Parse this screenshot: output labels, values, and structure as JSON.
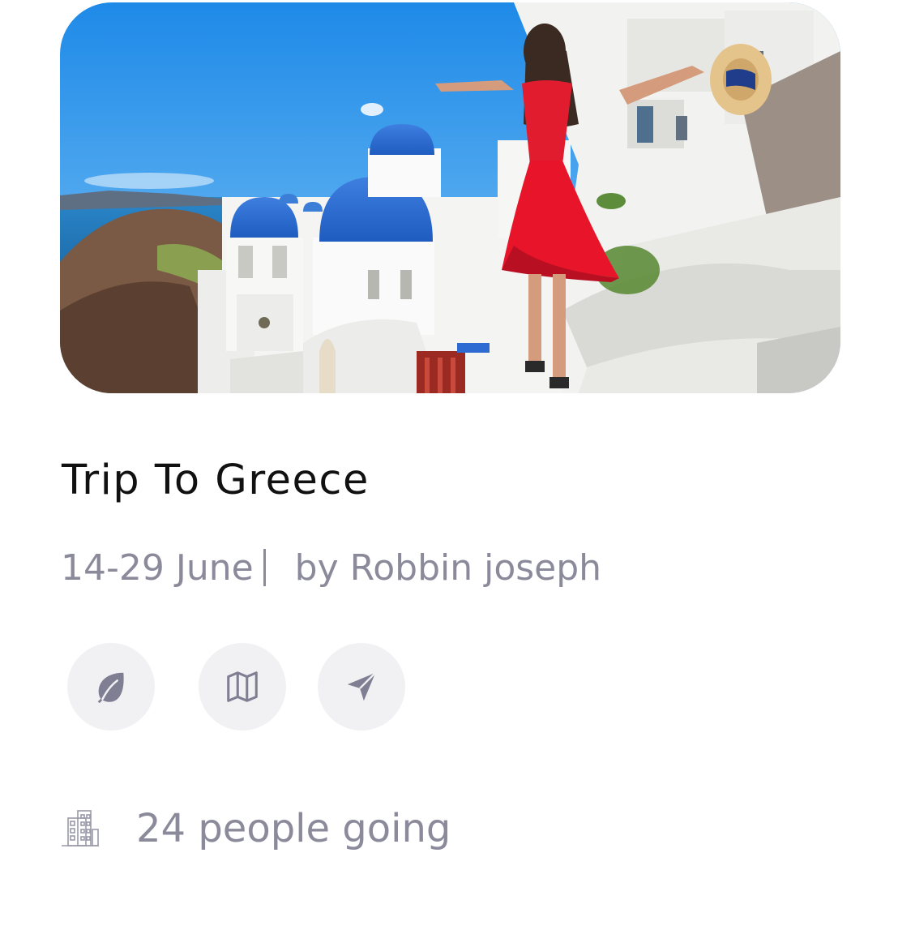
{
  "trip": {
    "title": "Trip To Greece",
    "dates": "14-29 June",
    "organizer": "by Robbin joseph",
    "attendance": "24 people going"
  },
  "actions": [
    {
      "icon": "leaf-icon"
    },
    {
      "icon": "map-icon"
    },
    {
      "icon": "send-icon"
    }
  ],
  "colors": {
    "title": "#111111",
    "secondary_text": "#8b8a9b",
    "icon_background": "#f1f0f3",
    "icon": "#7f7e92"
  }
}
